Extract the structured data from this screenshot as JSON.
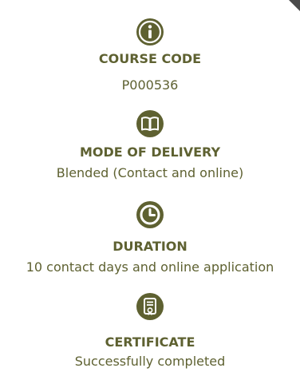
{
  "accent_color": "#5e6131",
  "items": [
    {
      "icon": "info-icon",
      "heading": "COURSE CODE",
      "value": "P000536"
    },
    {
      "icon": "book-icon",
      "heading": "MODE OF DELIVERY",
      "value": "Blended (Contact and online)"
    },
    {
      "icon": "clock-icon",
      "heading": "DURATION",
      "value": "10 contact days and online application"
    },
    {
      "icon": "certificate-icon",
      "heading": "CERTIFICATE",
      "value": "Successfully completed"
    }
  ]
}
